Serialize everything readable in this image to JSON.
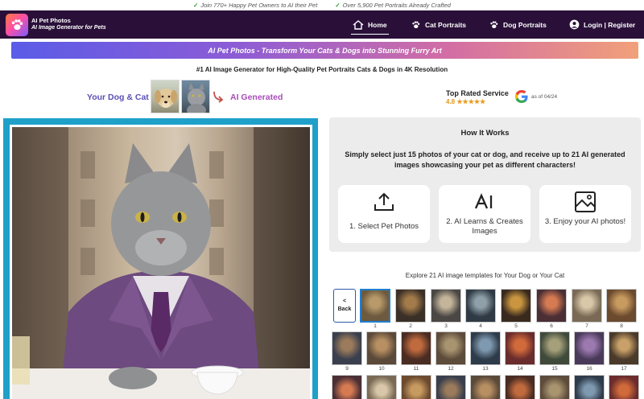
{
  "topstrip": {
    "item1": "Join 770+ Happy Pet Owners to AI their Pet",
    "item2": "Over 5,900 Pet Portraits Already Crafted"
  },
  "nav": {
    "brand_title": "AI Pet Photos",
    "brand_subtitle": "AI Image Generator for Pets",
    "home": "Home",
    "cat_portraits": "Cat Portraits",
    "dog_portraits": "Dog Portraits",
    "login": "Login | Register"
  },
  "banner": "AI Pet Photos - Transform Your Cats & Dogs into Stunning Furry Art",
  "subheading": "#1 AI Image Generator for High-Quality Pet Portraits Cats & Dogs in 4K Resolution",
  "showcase": {
    "your_dog_cat": "Your Dog & Cat",
    "ai_generated": "AI Generated"
  },
  "rating": {
    "title": "Top Rated Service",
    "score": "4.8 ★★★★★",
    "as_of": "as of 04/24"
  },
  "how_it_works": {
    "title": "How It Works",
    "description": "Simply select just 15 photos of your cat or dog, and receive up to 21 AI generated images showcasing your pet as different characters!",
    "steps": [
      {
        "label": "1. Select Pet Photos",
        "icon": "upload-icon"
      },
      {
        "label": "2. AI Learns & Creates Images",
        "icon": "ai-icon"
      },
      {
        "label": "3. Enjoy your AI photos!",
        "icon": "image-icon"
      }
    ]
  },
  "templates": {
    "heading": "Explore 21 AI image templates for Your Dog or Your Cat",
    "back_arrow": "<",
    "back_label": "Back",
    "numbers": [
      "1",
      "2",
      "3",
      "4",
      "5",
      "6",
      "7",
      "8",
      "9",
      "10",
      "11",
      "12",
      "13",
      "14",
      "15",
      "16",
      "17"
    ]
  },
  "colors": {
    "nav_bg": "#2a1039",
    "accent_blue": "#1ea0c9",
    "purple_text": "#5a4fb5",
    "magenta_text": "#a84db8",
    "star": "#e79a1b"
  }
}
